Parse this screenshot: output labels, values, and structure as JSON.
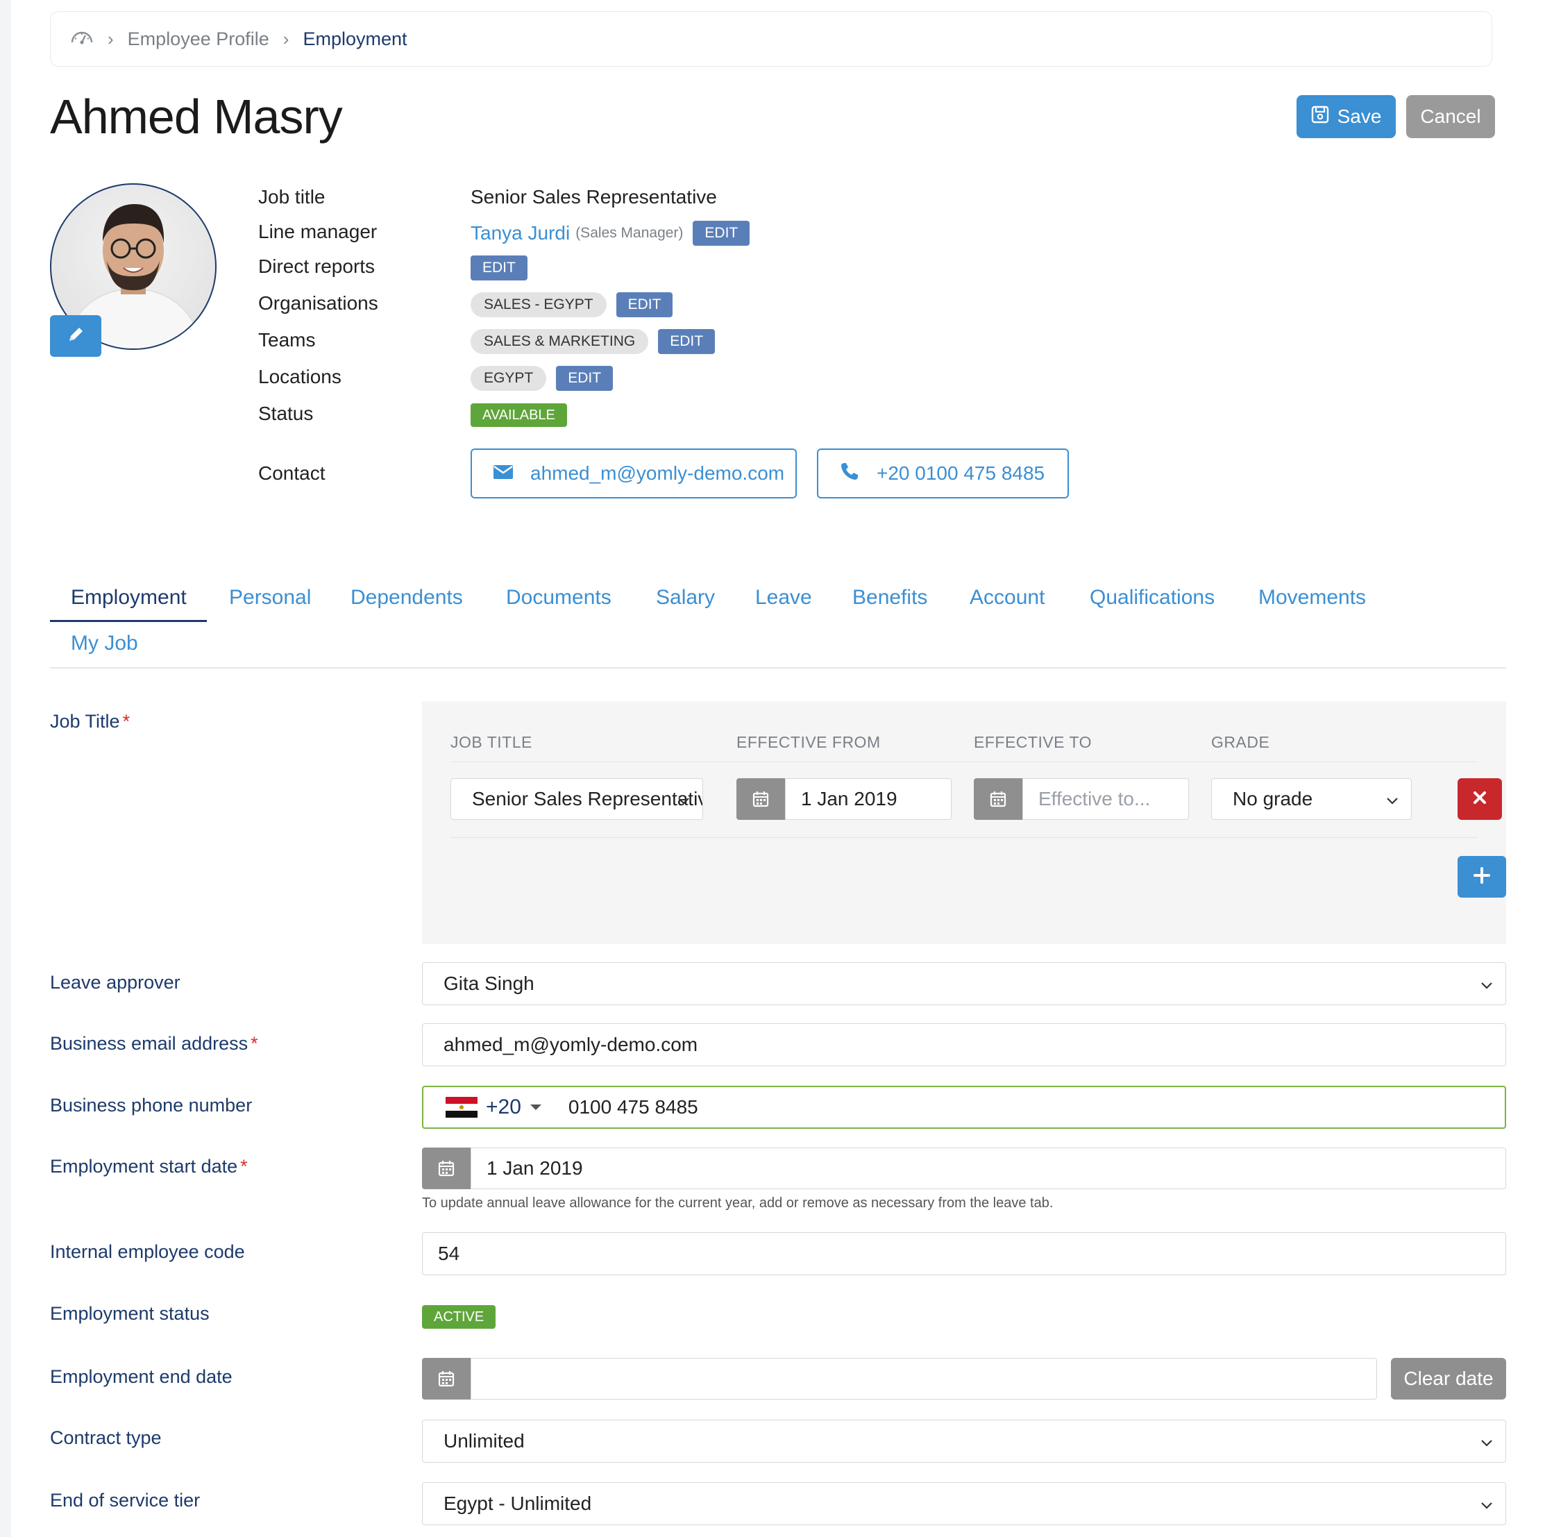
{
  "breadcrumb": {
    "home_icon": "dashboard-icon",
    "items": [
      "Employee Profile",
      "Employment"
    ]
  },
  "header": {
    "title": "Ahmed Masry",
    "save_label": "Save",
    "cancel_label": "Cancel"
  },
  "profile": {
    "labels": {
      "job_title": "Job title",
      "line_manager": "Line manager",
      "direct_reports": "Direct reports",
      "organisations": "Organisations",
      "teams": "Teams",
      "locations": "Locations",
      "status": "Status",
      "contact": "Contact"
    },
    "job_title": "Senior Sales Representative",
    "line_manager": {
      "name": "Tanya Jurdi",
      "role": "(Sales Manager)"
    },
    "edit_label": "EDIT",
    "organisation": "SALES - EGYPT",
    "team": "SALES & MARKETING",
    "location": "EGYPT",
    "status": "AVAILABLE",
    "email": "ahmed_m@yomly-demo.com",
    "phone": "+20 0100 475 8485"
  },
  "tabs": [
    "Employment",
    "Personal",
    "Dependents",
    "Documents",
    "Salary",
    "Leave",
    "Benefits",
    "Account",
    "Qualifications",
    "Movements",
    "My Job"
  ],
  "form": {
    "job_title": {
      "label": "Job Title",
      "columns": [
        "JOB TITLE",
        "EFFECTIVE FROM",
        "EFFECTIVE TO",
        "GRADE"
      ],
      "row": {
        "title": "Senior Sales Representative",
        "from": "1 Jan 2019",
        "to_placeholder": "Effective to...",
        "grade": "No grade"
      }
    },
    "leave_approver": {
      "label": "Leave approver",
      "value": "Gita Singh"
    },
    "business_email": {
      "label": "Business email address",
      "value": "ahmed_m@yomly-demo.com"
    },
    "business_phone": {
      "label": "Business phone number",
      "dial_code": "+20",
      "number": "0100 475 8485"
    },
    "start_date": {
      "label": "Employment start date",
      "value": "1 Jan 2019",
      "hint": "To update annual leave allowance for the current year, add or remove as necessary from the leave tab."
    },
    "employee_code": {
      "label": "Internal employee code",
      "value": "54"
    },
    "employment_status": {
      "label": "Employment status",
      "value": "ACTIVE"
    },
    "end_date": {
      "label": "Employment end date",
      "value": "",
      "clear_label": "Clear date"
    },
    "contract_type": {
      "label": "Contract type",
      "value": "Unlimited"
    },
    "end_of_service": {
      "label": "End of service tier",
      "value": "Egypt - Unlimited"
    }
  },
  "colors": {
    "accent": "#3b8fd3",
    "navy": "#1d3a6b",
    "edit_badge": "#5a7fb8",
    "success": "#5fa63a",
    "danger": "#c8282c",
    "neutral_button": "#9a9a9a"
  }
}
